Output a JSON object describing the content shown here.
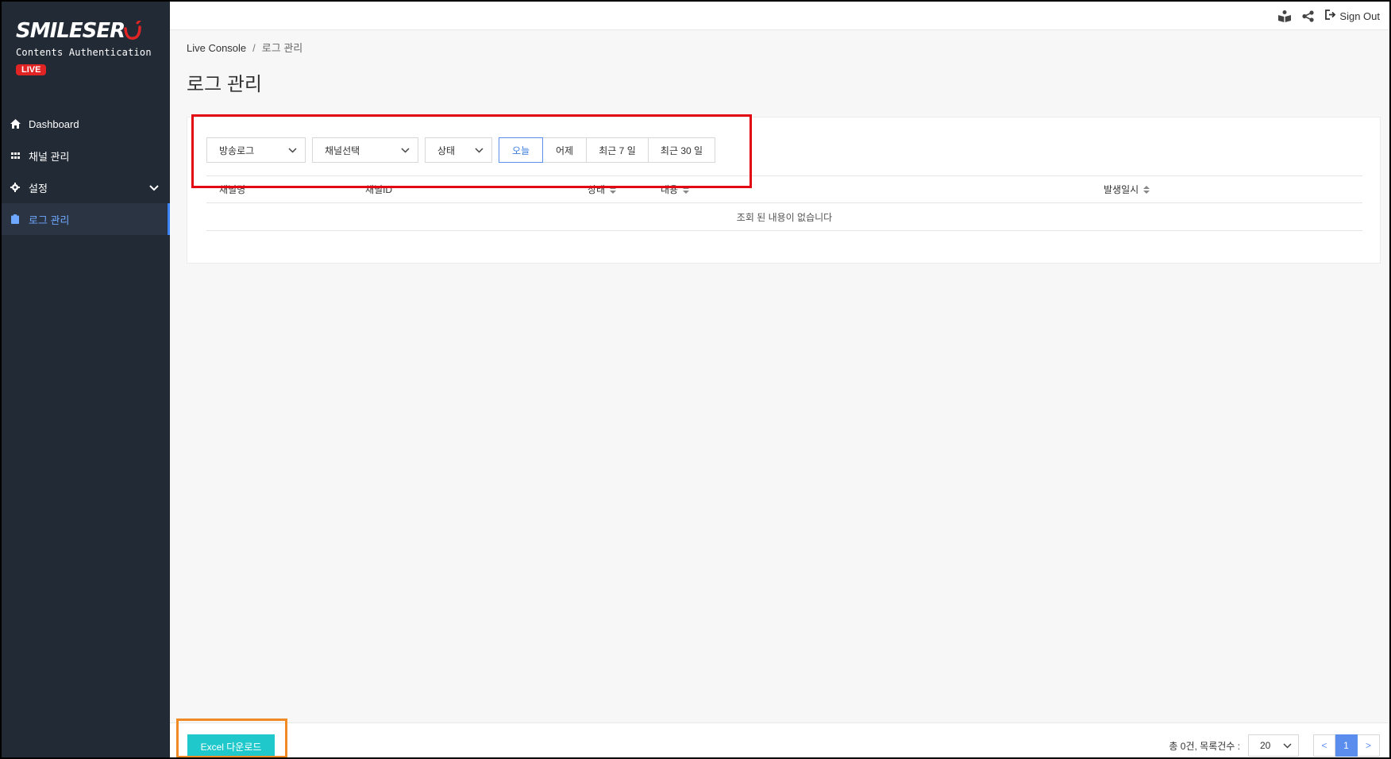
{
  "brand": {
    "name": "SMILESER",
    "subtitle": "Contents Authentication",
    "badge": "LIVE"
  },
  "sidebar": {
    "items": [
      {
        "label": "Dashboard",
        "icon": "home-icon"
      },
      {
        "label": "채널 관리",
        "icon": "grid-icon"
      },
      {
        "label": "설정",
        "icon": "gear-icon"
      },
      {
        "label": "로그 관리",
        "icon": "clipboard-icon"
      }
    ]
  },
  "topbar": {
    "signout_label": "Sign Out"
  },
  "breadcrumb": {
    "root": "Live Console",
    "separator": "/",
    "current": "로그 관리"
  },
  "page_title": "로그 관리",
  "filters": {
    "log_type": "방송로그",
    "channel": "채널선택",
    "status": "상태",
    "date_buttons": [
      "오늘",
      "어제",
      "최근 7 일",
      "최근 30 일"
    ],
    "active_date": "오늘"
  },
  "table": {
    "columns": [
      "채널명",
      "채널ID",
      "상태",
      "내용",
      "발생일시"
    ],
    "empty_message": "조회 된 내용이 없습니다"
  },
  "footer": {
    "excel_label": "Excel 다운로드",
    "total_label": "총 0건, 목록건수 :",
    "page_size": "20",
    "prev": "<",
    "current_page": "1",
    "next": ">"
  },
  "colors": {
    "sidebar_bg": "#222a36",
    "accent": "#5b8def",
    "excel_button": "#1ec8cb",
    "live_badge": "#e02424",
    "highlight_red": "#e30613",
    "highlight_orange": "#f08a24"
  }
}
